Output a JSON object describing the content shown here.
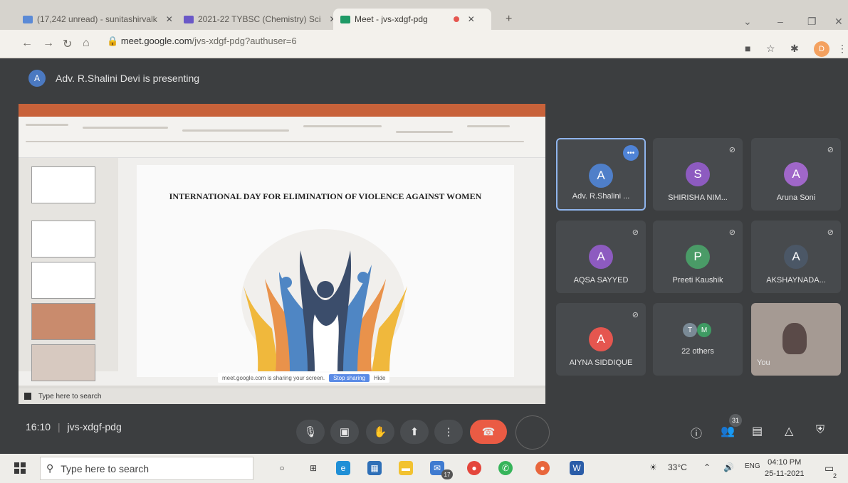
{
  "browser": {
    "tabs": [
      {
        "label": "(17,242 unread) - sunitashirvalk",
        "color": "#5b8ad6"
      },
      {
        "label": "2021-22 TYBSC (Chemistry) Sci",
        "color": "#6a58c7"
      },
      {
        "label": "Meet - jvs-xdgf-pdg",
        "color": "#1f9a66"
      }
    ],
    "new_tab": "+",
    "url_domain": "meet.google.com",
    "url_path": "/jvs-xdgf-pdg?authuser=6",
    "profile_initial": "D"
  },
  "meet": {
    "presenter_initial": "A",
    "presenting_text": "Adv. R.Shalini Devi is presenting",
    "slide_title": "INTERNATIONAL DAY FOR ELIMINATION OF VIOLENCE AGAINST WOMEN",
    "inner_search": "Type here to search",
    "notify_text": "meet.google.com is sharing your screen.",
    "notify_stop": "Stop sharing",
    "notify_hide": "Hide",
    "participants": [
      {
        "initial": "A",
        "name": "Adv. R.Shalini ...",
        "color": "#4f7fc9"
      },
      {
        "initial": "S",
        "name": "SHIRISHA NIM...",
        "color": "#8d5bc0"
      },
      {
        "initial": "A",
        "name": "Aruna Soni",
        "color": "#a067c9"
      },
      {
        "initial": "A",
        "name": "AQSA SAYYED",
        "color": "#8d5bc0"
      },
      {
        "initial": "P",
        "name": "Preeti Kaushik",
        "color": "#4a9b67"
      },
      {
        "initial": "A",
        "name": "AKSHAYNADA...",
        "color": "#4b5766"
      },
      {
        "initial": "A",
        "name": "AIYNA SIDDIQUE",
        "color": "#e5564f"
      },
      {
        "initial": "",
        "name": "22 others",
        "color": "#3f9b63"
      },
      {
        "initial": "",
        "name": "You",
        "color": "#a59a93"
      }
    ],
    "others_initials": [
      "T",
      "M"
    ],
    "time": "16:10",
    "meeting_code": "jvs-xdgf-pdg",
    "people_count": "31"
  },
  "taskbar": {
    "search_placeholder": "Type here to search",
    "mail_badge": "17",
    "temperature": "33°C",
    "language": "ENG",
    "clock_time": "04:10 PM",
    "clock_date": "25-11-2021",
    "notif_count": "2"
  }
}
